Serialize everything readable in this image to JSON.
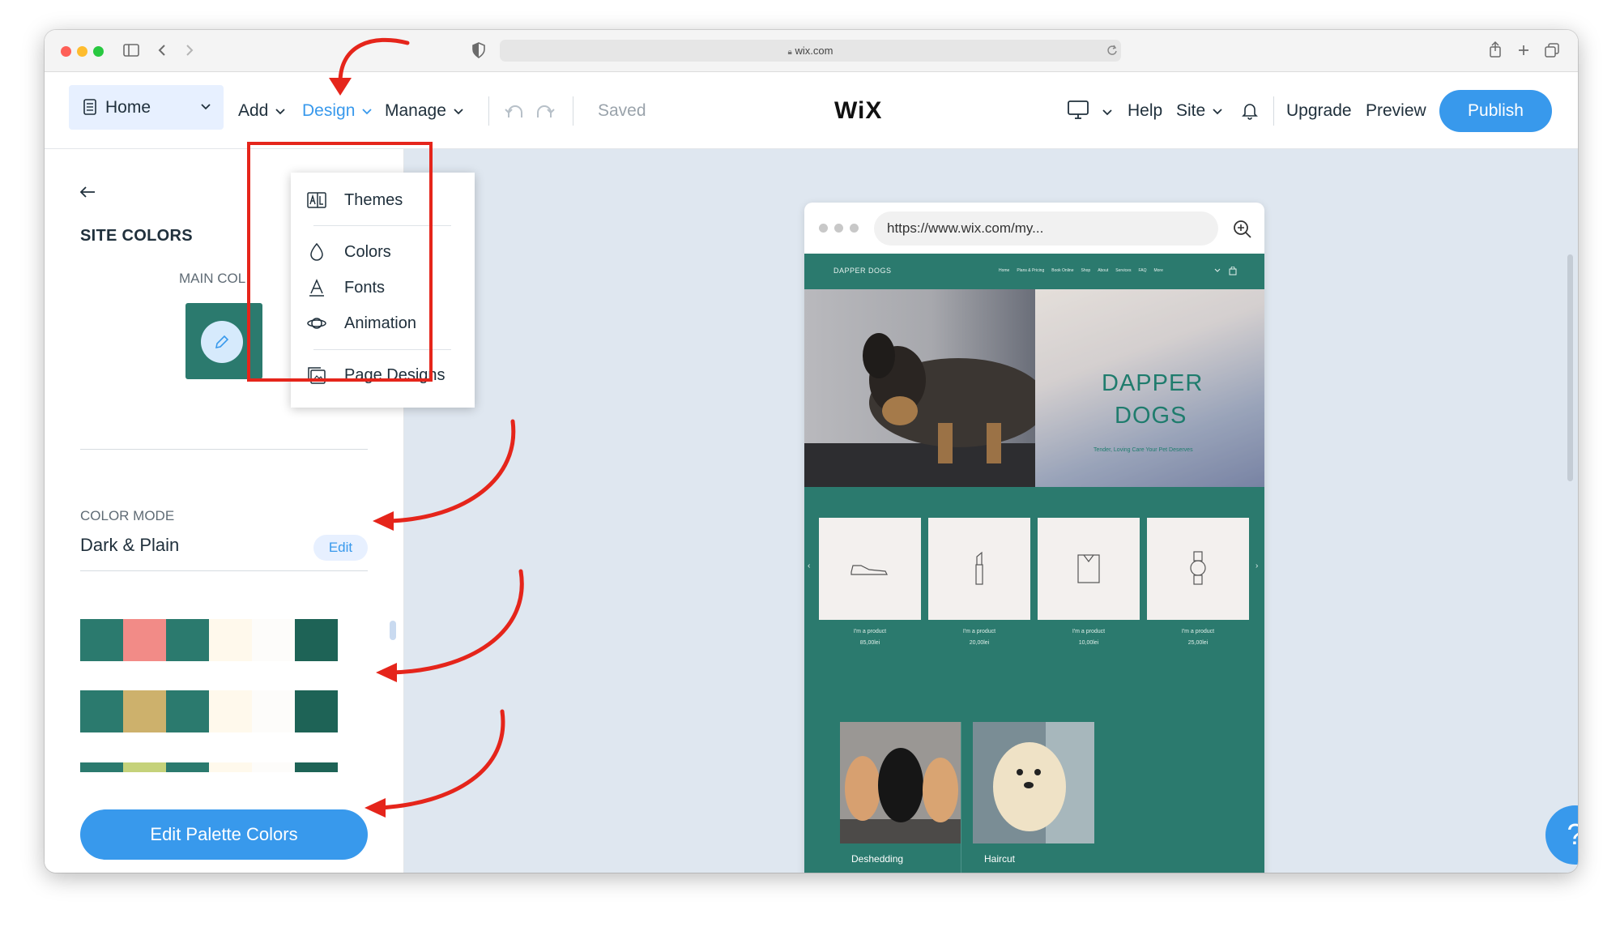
{
  "browser": {
    "url": "wix.com"
  },
  "topbar": {
    "page_select": "Home",
    "menu": {
      "add": "Add",
      "design": "Design",
      "manage": "Manage"
    },
    "status": "Saved",
    "logo": "WiX",
    "right": {
      "help": "Help",
      "site": "Site",
      "upgrade": "Upgrade",
      "preview": "Preview",
      "publish": "Publish"
    },
    "colors": {
      "accent": "#3899ec",
      "active_menu": "#3899ec"
    }
  },
  "design_menu": {
    "items": [
      {
        "label": "Themes",
        "icon": "themes-icon"
      },
      {
        "label": "Colors",
        "icon": "droplet-icon"
      },
      {
        "label": "Fonts",
        "icon": "font-icon"
      },
      {
        "label": "Animation",
        "icon": "planet-icon"
      },
      {
        "label": "Page Designs",
        "icon": "page-designs-icon"
      }
    ]
  },
  "panel": {
    "title": "SITE COLORS",
    "main_colors_label": "MAIN COL",
    "color_mode_label": "COLOR MODE",
    "color_mode_value": "Dark & Plain",
    "edit_label": "Edit",
    "edit_palette_button": "Edit Palette Colors",
    "palettes": [
      [
        "#2b7a6e",
        "#f28b87",
        "#2b7a6e",
        "#fff9ec",
        "#fdfcfa",
        "#1e6356"
      ],
      [
        "#2b7a6e",
        "#cdb16c",
        "#2b7a6e",
        "#fff9ec",
        "#fdfcfa",
        "#1e6356"
      ],
      [
        "#2b7a6e",
        "#c5d27a",
        "#2b7a6e",
        "#fff9ec",
        "#fdfcfa",
        "#1e6356"
      ]
    ]
  },
  "preview": {
    "url": "https://www.wix.com/my...",
    "site_name": "DAPPER DOGS",
    "nav": [
      "Home",
      "Plans & Pricing",
      "Book Online",
      "Shop",
      "About",
      "Services",
      "FAQ",
      "More"
    ],
    "hero_title_1": "DAPPER",
    "hero_title_2": "DOGS",
    "hero_subtitle": "Tender, Loving Care Your Pet Deserves",
    "products": [
      {
        "name": "I'm a product",
        "price": "85,00lei"
      },
      {
        "name": "I'm a product",
        "price": "20,00lei"
      },
      {
        "name": "I'm a product",
        "price": "10,00lei"
      },
      {
        "name": "I'm a product",
        "price": "25,00lei"
      }
    ],
    "services": [
      "Deshedding",
      "Haircut"
    ],
    "site_color": "#2b7a6e"
  },
  "help_fab": "?"
}
